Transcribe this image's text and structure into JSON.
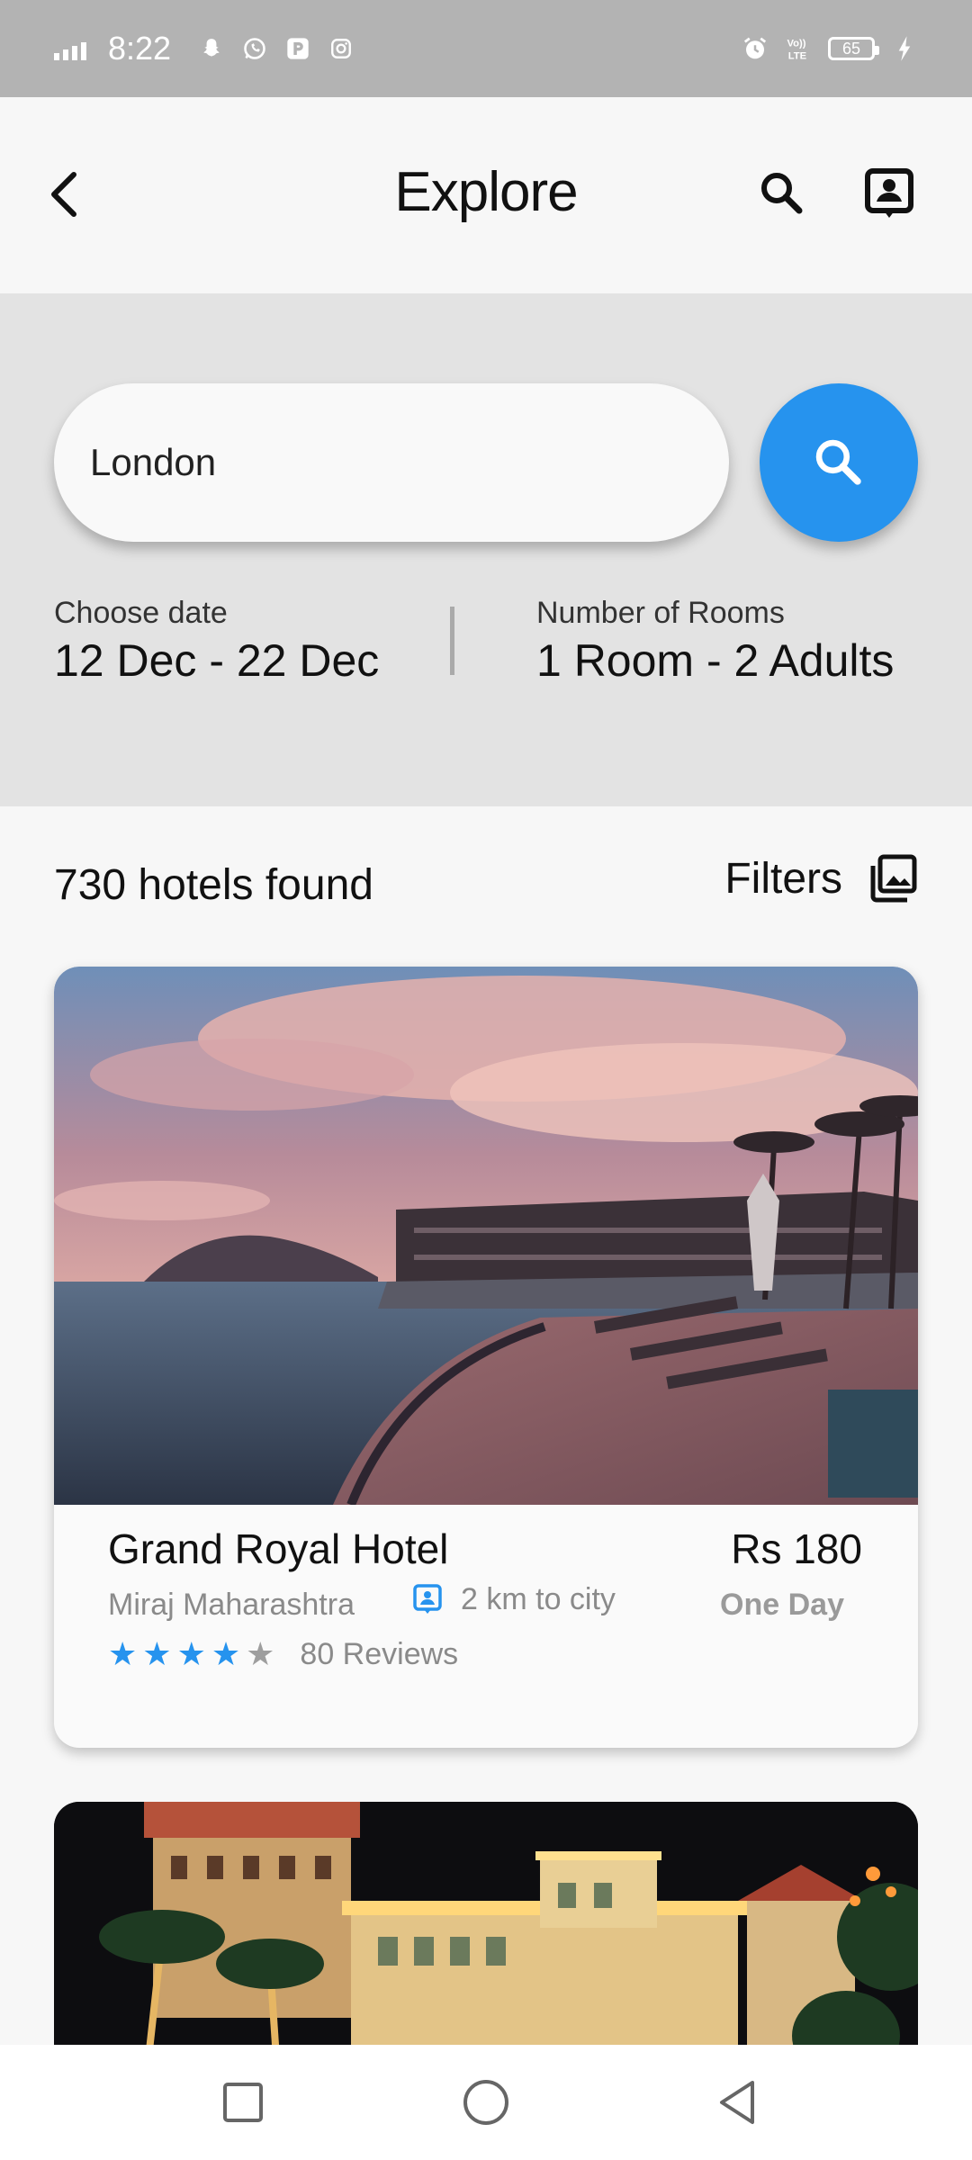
{
  "status_bar": {
    "time": "8:22",
    "battery": "65",
    "icons": [
      "signal-icon",
      "snapchat-icon",
      "whatsapp-icon",
      "paytm-icon",
      "instagram-icon",
      "alarm-icon",
      "volte-icon",
      "battery-icon",
      "charging-icon"
    ]
  },
  "app_bar": {
    "title": "Explore",
    "icons": [
      "back-icon",
      "search-icon",
      "profile-icon"
    ]
  },
  "search": {
    "location_value": "London",
    "date_label": "Choose date",
    "date_value": "12 Dec - 22 Dec",
    "rooms_label": "Number of Rooms",
    "rooms_value": "1 Room - 2 Adults"
  },
  "results": {
    "count_label": "730 hotels found",
    "filters_label": "Filters"
  },
  "hotels": [
    {
      "name": "Grand Royal Hotel",
      "price": "Rs 180",
      "location": "Miraj Maharashtra",
      "distance": "2 km to city",
      "period": "One Day",
      "rating": 4,
      "rating_max": 5,
      "reviews": "80 Reviews"
    }
  ],
  "colors": {
    "accent": "#2693ee",
    "status_bar": "#b3b3b3",
    "search_panel": "#e3e3e3"
  },
  "nav_bar": {
    "icons": [
      "recent-apps-icon",
      "home-icon",
      "back-nav-icon"
    ]
  }
}
